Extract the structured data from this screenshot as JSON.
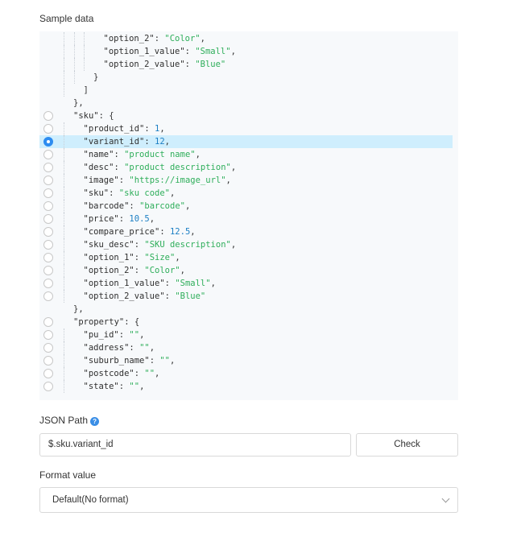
{
  "sample_data": {
    "label": "Sample data",
    "lines": [
      {
        "indent": 3,
        "tokens": [
          {
            "t": "k",
            "v": "\"option_2\""
          },
          {
            "t": "p",
            "v": ": "
          },
          {
            "t": "s",
            "v": "\"Color\""
          },
          {
            "t": "p",
            "v": ","
          }
        ]
      },
      {
        "indent": 3,
        "tokens": [
          {
            "t": "k",
            "v": "\"option_1_value\""
          },
          {
            "t": "p",
            "v": ": "
          },
          {
            "t": "s",
            "v": "\"Small\""
          },
          {
            "t": "p",
            "v": ","
          }
        ]
      },
      {
        "indent": 3,
        "tokens": [
          {
            "t": "k",
            "v": "\"option_2_value\""
          },
          {
            "t": "p",
            "v": ": "
          },
          {
            "t": "s",
            "v": "\"Blue\""
          }
        ]
      },
      {
        "indent": 2,
        "tokens": [
          {
            "t": "p",
            "v": "}"
          }
        ]
      },
      {
        "indent": 1,
        "tokens": [
          {
            "t": "p",
            "v": "]"
          }
        ]
      },
      {
        "indent": 0,
        "tokens": [
          {
            "t": "p",
            "v": "},"
          }
        ]
      },
      {
        "indent": 0,
        "radio": true,
        "tokens": [
          {
            "t": "k",
            "v": "\"sku\""
          },
          {
            "t": "p",
            "v": ": {"
          }
        ]
      },
      {
        "indent": 1,
        "radio": true,
        "tokens": [
          {
            "t": "k",
            "v": "\"product_id\""
          },
          {
            "t": "p",
            "v": ": "
          },
          {
            "t": "n",
            "v": "1"
          },
          {
            "t": "p",
            "v": ","
          }
        ]
      },
      {
        "indent": 1,
        "radio": true,
        "selected": true,
        "tokens": [
          {
            "t": "k",
            "v": "\"variant_id\""
          },
          {
            "t": "p",
            "v": ": "
          },
          {
            "t": "n",
            "v": "12"
          },
          {
            "t": "p",
            "v": ","
          }
        ]
      },
      {
        "indent": 1,
        "radio": true,
        "tokens": [
          {
            "t": "k",
            "v": "\"name\""
          },
          {
            "t": "p",
            "v": ": "
          },
          {
            "t": "s",
            "v": "\"product name\""
          },
          {
            "t": "p",
            "v": ","
          }
        ]
      },
      {
        "indent": 1,
        "radio": true,
        "tokens": [
          {
            "t": "k",
            "v": "\"desc\""
          },
          {
            "t": "p",
            "v": ": "
          },
          {
            "t": "s",
            "v": "\"product description\""
          },
          {
            "t": "p",
            "v": ","
          }
        ]
      },
      {
        "indent": 1,
        "radio": true,
        "tokens": [
          {
            "t": "k",
            "v": "\"image\""
          },
          {
            "t": "p",
            "v": ": "
          },
          {
            "t": "s",
            "v": "\"https://image_url\""
          },
          {
            "t": "p",
            "v": ","
          }
        ]
      },
      {
        "indent": 1,
        "radio": true,
        "tokens": [
          {
            "t": "k",
            "v": "\"sku\""
          },
          {
            "t": "p",
            "v": ": "
          },
          {
            "t": "s",
            "v": "\"sku code\""
          },
          {
            "t": "p",
            "v": ","
          }
        ]
      },
      {
        "indent": 1,
        "radio": true,
        "tokens": [
          {
            "t": "k",
            "v": "\"barcode\""
          },
          {
            "t": "p",
            "v": ": "
          },
          {
            "t": "s",
            "v": "\"barcode\""
          },
          {
            "t": "p",
            "v": ","
          }
        ]
      },
      {
        "indent": 1,
        "radio": true,
        "tokens": [
          {
            "t": "k",
            "v": "\"price\""
          },
          {
            "t": "p",
            "v": ": "
          },
          {
            "t": "n",
            "v": "10.5"
          },
          {
            "t": "p",
            "v": ","
          }
        ]
      },
      {
        "indent": 1,
        "radio": true,
        "tokens": [
          {
            "t": "k",
            "v": "\"compare_price\""
          },
          {
            "t": "p",
            "v": ": "
          },
          {
            "t": "n",
            "v": "12.5"
          },
          {
            "t": "p",
            "v": ","
          }
        ]
      },
      {
        "indent": 1,
        "radio": true,
        "tokens": [
          {
            "t": "k",
            "v": "\"sku_desc\""
          },
          {
            "t": "p",
            "v": ": "
          },
          {
            "t": "s",
            "v": "\"SKU description\""
          },
          {
            "t": "p",
            "v": ","
          }
        ]
      },
      {
        "indent": 1,
        "radio": true,
        "tokens": [
          {
            "t": "k",
            "v": "\"option_1\""
          },
          {
            "t": "p",
            "v": ": "
          },
          {
            "t": "s",
            "v": "\"Size\""
          },
          {
            "t": "p",
            "v": ","
          }
        ]
      },
      {
        "indent": 1,
        "radio": true,
        "tokens": [
          {
            "t": "k",
            "v": "\"option_2\""
          },
          {
            "t": "p",
            "v": ": "
          },
          {
            "t": "s",
            "v": "\"Color\""
          },
          {
            "t": "p",
            "v": ","
          }
        ]
      },
      {
        "indent": 1,
        "radio": true,
        "tokens": [
          {
            "t": "k",
            "v": "\"option_1_value\""
          },
          {
            "t": "p",
            "v": ": "
          },
          {
            "t": "s",
            "v": "\"Small\""
          },
          {
            "t": "p",
            "v": ","
          }
        ]
      },
      {
        "indent": 1,
        "radio": true,
        "tokens": [
          {
            "t": "k",
            "v": "\"option_2_value\""
          },
          {
            "t": "p",
            "v": ": "
          },
          {
            "t": "s",
            "v": "\"Blue\""
          }
        ]
      },
      {
        "indent": 0,
        "tokens": [
          {
            "t": "p",
            "v": "},"
          }
        ]
      },
      {
        "indent": 0,
        "radio": true,
        "tokens": [
          {
            "t": "k",
            "v": "\"property\""
          },
          {
            "t": "p",
            "v": ": {"
          }
        ]
      },
      {
        "indent": 1,
        "radio": true,
        "tokens": [
          {
            "t": "k",
            "v": "\"pu_id\""
          },
          {
            "t": "p",
            "v": ": "
          },
          {
            "t": "s",
            "v": "\"\""
          },
          {
            "t": "p",
            "v": ","
          }
        ]
      },
      {
        "indent": 1,
        "radio": true,
        "tokens": [
          {
            "t": "k",
            "v": "\"address\""
          },
          {
            "t": "p",
            "v": ": "
          },
          {
            "t": "s",
            "v": "\"\""
          },
          {
            "t": "p",
            "v": ","
          }
        ]
      },
      {
        "indent": 1,
        "radio": true,
        "tokens": [
          {
            "t": "k",
            "v": "\"suburb_name\""
          },
          {
            "t": "p",
            "v": ": "
          },
          {
            "t": "s",
            "v": "\"\""
          },
          {
            "t": "p",
            "v": ","
          }
        ]
      },
      {
        "indent": 1,
        "radio": true,
        "tokens": [
          {
            "t": "k",
            "v": "\"postcode\""
          },
          {
            "t": "p",
            "v": ": "
          },
          {
            "t": "s",
            "v": "\"\""
          },
          {
            "t": "p",
            "v": ","
          }
        ]
      },
      {
        "indent": 1,
        "radio": true,
        "tokens": [
          {
            "t": "k",
            "v": "\"state\""
          },
          {
            "t": "p",
            "v": ": "
          },
          {
            "t": "s",
            "v": "\"\""
          },
          {
            "t": "p",
            "v": ","
          }
        ]
      }
    ]
  },
  "json_path": {
    "label": "JSON Path",
    "help_icon": "question-circle-icon",
    "value": "$.sku.variant_id",
    "check_label": "Check"
  },
  "format_value": {
    "label": "Format value",
    "selected": "Default(No format)",
    "icon": "chevron-down-icon"
  },
  "colors": {
    "key": "#2f2f2f",
    "string": "#2eae5a",
    "number": "#1c7fc4",
    "selected_row": "#cfeefd",
    "radio_checked": "#2d8cf0"
  }
}
